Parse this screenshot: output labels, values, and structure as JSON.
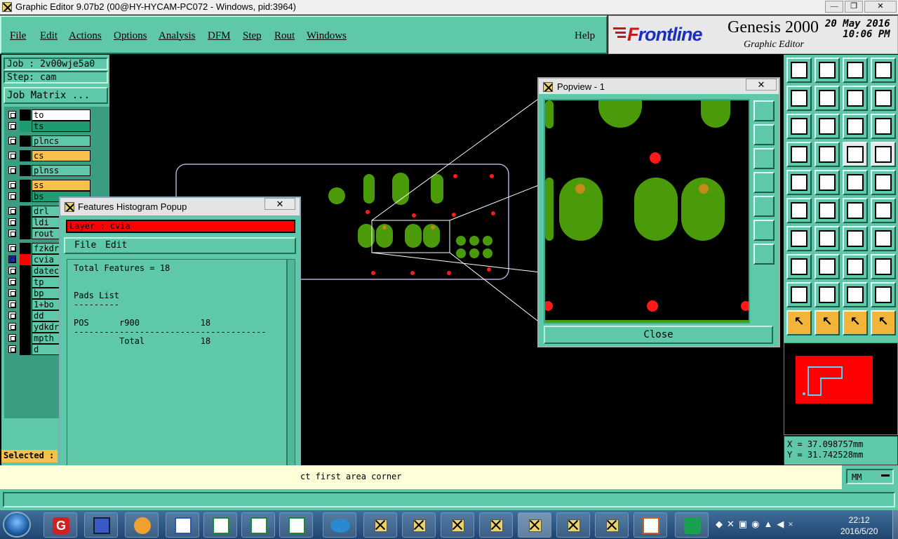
{
  "window": {
    "title": "Graphic Editor 9.07b2 (00@HY-HYCAM-PC072 - Windows, pid:3964)",
    "min": "—",
    "max": "❐",
    "close": "✕"
  },
  "menu": {
    "items": [
      "File",
      "Edit",
      "Actions",
      "Options",
      "Analysis",
      "DFM",
      "Step",
      "Rout",
      "Windows"
    ],
    "help": "Help"
  },
  "brand": {
    "logo_a": "F",
    "logo_b": "rontline",
    "product": "Genesis 2000",
    "subtitle": "Graphic Editor",
    "date": "20 May 2016",
    "time": "10:06 PM"
  },
  "job": {
    "job": "Job : 2v00wje5a0",
    "step": "Step: cam",
    "matrix": "Job Matrix ..."
  },
  "layers": [
    {
      "name": "to",
      "color": "#ffffff"
    },
    {
      "name": "ts",
      "color": "#1f9b72"
    },
    {
      "name": "plncs",
      "color": "#5fc8a8"
    },
    {
      "name": "cs",
      "color": "#f7c04a"
    },
    {
      "name": "plnss",
      "color": "#5fc8a8"
    },
    {
      "name": "ss",
      "color": "#f7c04a"
    },
    {
      "name": "bs",
      "color": "#1f9b72"
    },
    {
      "name": "drl",
      "color": "#5fc8a8"
    },
    {
      "name": "ldi",
      "color": "#5fc8a8"
    },
    {
      "name": "rout",
      "color": "#5fc8a8"
    },
    {
      "name": "fzkdrl",
      "color": "#5fc8a8"
    },
    {
      "name": "cvia",
      "color": "#5fc8a8"
    },
    {
      "name": "datecode",
      "color": "#5fc8a8"
    },
    {
      "name": "tp",
      "color": "#5fc8a8"
    },
    {
      "name": "bp",
      "color": "#5fc8a8"
    },
    {
      "name": "1+bo",
      "color": "#5fc8a8"
    },
    {
      "name": "dd",
      "color": "#5fc8a8"
    },
    {
      "name": "ydkdrl",
      "color": "#5fc8a8"
    },
    {
      "name": "mpth",
      "color": "#5fc8a8"
    },
    {
      "name": "d",
      "color": "#5fc8a8"
    }
  ],
  "selected_label": "Selected :",
  "histogram": {
    "title": "Features Histogram Popup",
    "layer": "Layer :  cvia",
    "menu": [
      "File",
      "Edit"
    ],
    "content": "Total Features = 18\n\n\nPads List\n---------\n\nPOS      r900            18\n--------------------------------------\n         Total           18"
  },
  "popview": {
    "title": "Popview - 1",
    "close": "Close"
  },
  "status": {
    "message": "ct first area corner",
    "unit": "MM"
  },
  "coords": {
    "x": "X = 37.098757mm",
    "y": "Y = 31.742528mm"
  },
  "clock": {
    "time": "22:12",
    "date": "2016/5/20"
  }
}
